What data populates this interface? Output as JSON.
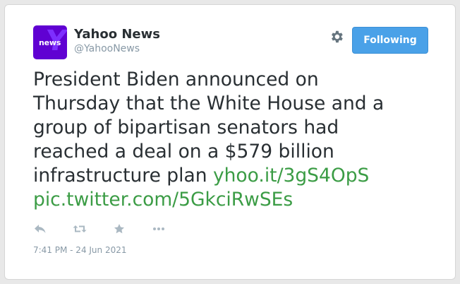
{
  "account": {
    "logo_text": "news",
    "name": "Yahoo News",
    "handle": "@YahooNews"
  },
  "header": {
    "settings_icon": "gear-icon",
    "follow_label": "Following"
  },
  "tweet": {
    "line1": "President Biden announced on",
    "line2": "Thursday that the White House and a",
    "line3": "group of bipartisan senators had",
    "line4": "reached a deal on a $579 billion",
    "line5_text": "infrastructure plan ",
    "link_url": "yhoo.it/3gS4OpS",
    "pic_link": "pic.twitter.com/5GkciRwSEs",
    "timestamp": "7:41 PM - 24 Jun 2021"
  },
  "actions": [
    {
      "icon": "reply-icon"
    },
    {
      "icon": "retweet-icon"
    },
    {
      "icon": "like-star-icon"
    },
    {
      "icon": "more-icon"
    }
  ],
  "colors": {
    "accent": "#4aa1e8",
    "link": "#3b9c45",
    "brand": "#6001d2",
    "text": "#292f33",
    "muted": "#8899a6"
  }
}
